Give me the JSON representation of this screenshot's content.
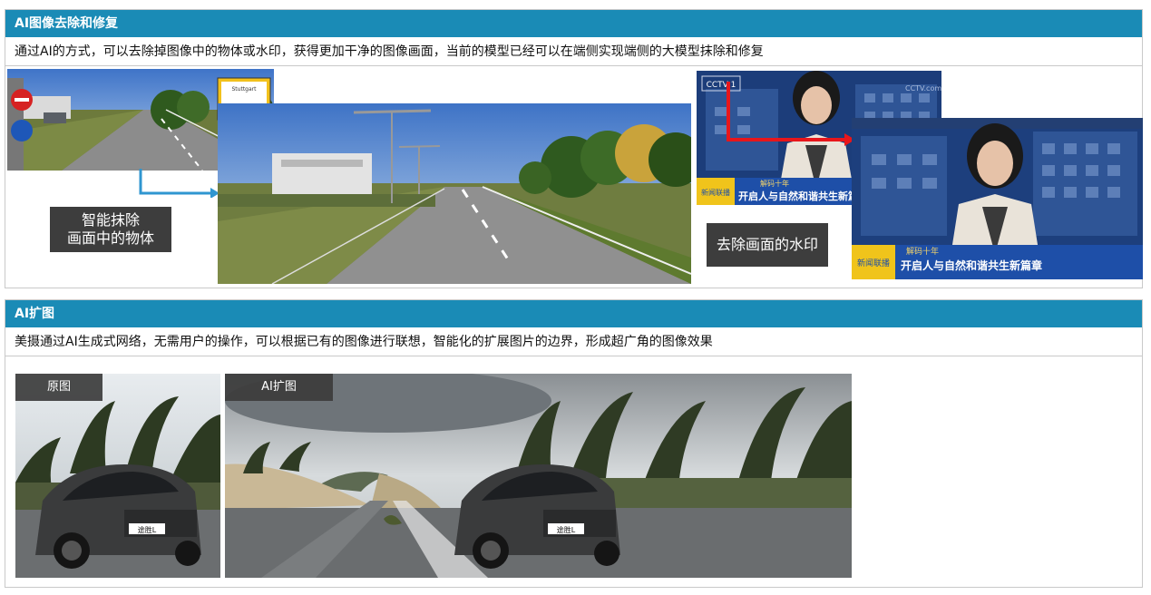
{
  "section1": {
    "title": "AI图像去除和修复",
    "description": "通过AI的方式，可以去除掉图像中的物体或水印，获得更加干净的图像画面，当前的模型已经可以在端侧实现端侧的大模型抹除和修复",
    "caption_left_line1": "智能抹除",
    "caption_left_line2": "画面中的物体",
    "caption_right": "去除画面的水印",
    "sign_text": "Stuttgart",
    "news_banner_small": "开启人与自然和谐共生新篇",
    "news_banner_large": "开启人与自然和谐共生新篇章",
    "news_tag": "解码十年",
    "cctv_logo": "CCTV 1",
    "news_logo": "新闻联播",
    "watermark_text": "CCTV.com"
  },
  "section2": {
    "title": "AI扩图",
    "description": "美摄通过AI生成式网络，无需用户的操作，可以根据已有的图像进行联想，智能化的扩展图片的边界，形成超广角的图像效果",
    "label_original": "原图",
    "label_expanded": "AI扩图",
    "plate_text": "途胜L"
  },
  "colors": {
    "header_bg": "#1a8bb6",
    "arrow_blue": "#2f96d0",
    "arrow_red": "#e8161b"
  }
}
